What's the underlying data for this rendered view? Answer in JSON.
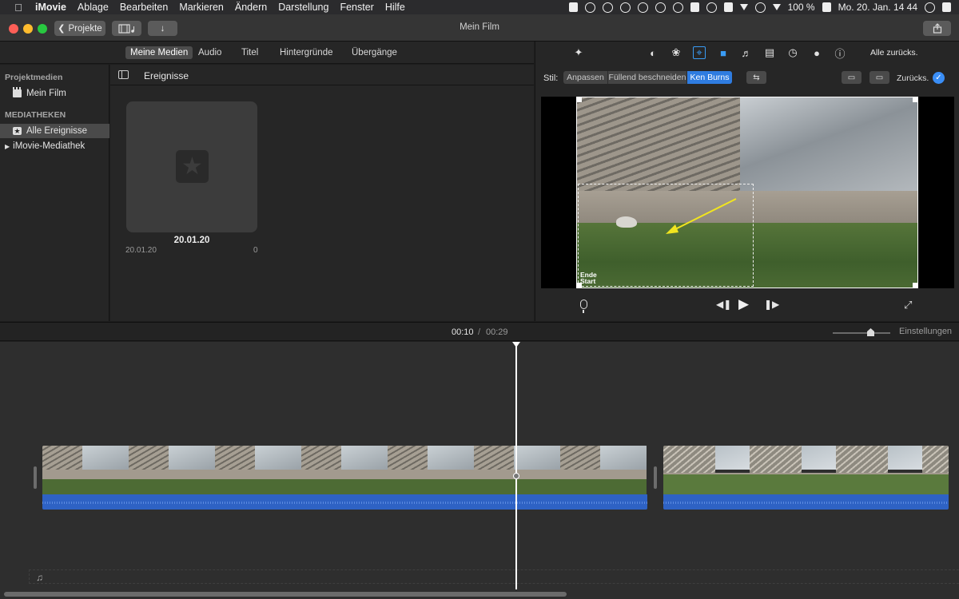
{
  "menubar": {
    "app": "iMovie",
    "items": [
      "Ablage",
      "Bearbeiten",
      "Markieren",
      "Ändern",
      "Darstellung",
      "Fenster",
      "Hilfe"
    ],
    "battery": "100 %",
    "clock": "Mo. 20. Jan. 14 44"
  },
  "toolbar": {
    "back_label": "Projekte",
    "window_title": "Mein Film"
  },
  "browser": {
    "tabs": [
      "Meine Medien",
      "Audio",
      "Titel",
      "Hintergründe",
      "Übergänge"
    ],
    "active_tab": "Meine Medien"
  },
  "sidebar": {
    "section_project": "Projektmedien",
    "project_item": "Mein Film",
    "section_libraries": "MEDIATHEKEN",
    "all_events": "Alle Ereignisse",
    "library": "iMovie-Mediathek"
  },
  "events": {
    "title": "Ereignisse",
    "card_title": "20.01.20",
    "card_date": "20.01.20",
    "card_count": "0"
  },
  "viewer": {
    "reset_all": "Alle zurücks.",
    "stil_label": "Stil:",
    "styles": [
      "Anpassen",
      "Füllend beschneiden",
      "Ken Burns"
    ],
    "active_style": "Ken Burns",
    "reset_label": "Zurücks.",
    "overlay_end": "Ende",
    "overlay_start": "Start"
  },
  "timeline": {
    "current_time": "00:10",
    "separator": "/",
    "total_time": "00:29",
    "settings_label": "Einstellungen"
  },
  "colors": {
    "accent": "#2f7ce0",
    "audio_track": "#2e62c4",
    "traffic_red": "#fe5f57",
    "traffic_yellow": "#febc2e",
    "traffic_green": "#28c840"
  }
}
